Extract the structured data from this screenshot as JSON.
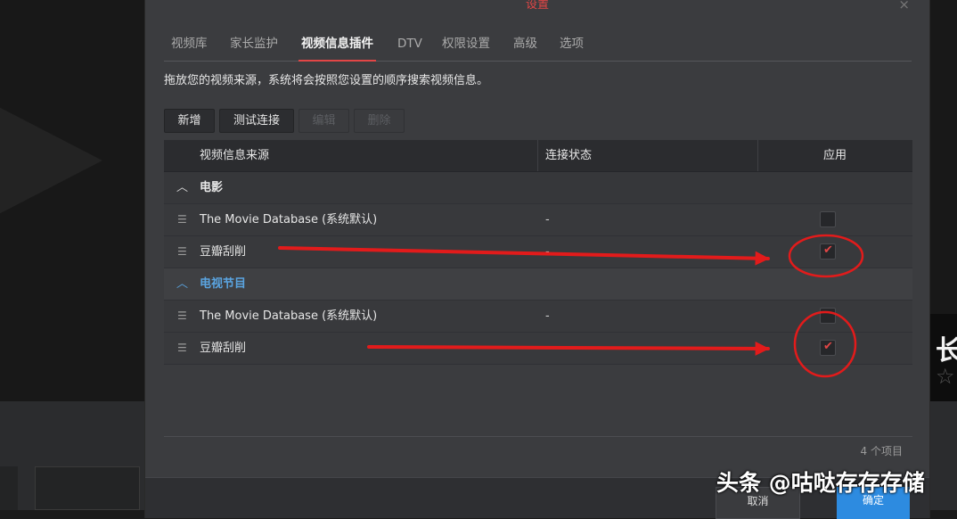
{
  "dialog": {
    "title": "设置",
    "close": "×"
  },
  "tabs": [
    {
      "label": "视频库"
    },
    {
      "label": "家长监护"
    },
    {
      "label": "视频信息插件",
      "active": true
    },
    {
      "label": "DTV"
    },
    {
      "label": "权限设置"
    },
    {
      "label": "高级"
    },
    {
      "label": "选项"
    }
  ],
  "description": "拖放您的视频来源，系统将会按照您设置的顺序搜索视频信息。",
  "toolbar": {
    "add": "新增",
    "test": "测试连接",
    "edit": "编辑",
    "delete": "删除"
  },
  "table": {
    "headers": {
      "source": "视频信息来源",
      "status": "连接状态",
      "apply": "应用"
    },
    "groups": [
      {
        "label": "电影",
        "rows": [
          {
            "name": "The Movie Database (系统默认)",
            "status": "-",
            "checked": false
          },
          {
            "name": "豆瓣刮削",
            "status": "-",
            "checked": true
          }
        ]
      },
      {
        "label": "电视节目",
        "rows": [
          {
            "name": "The Movie Database (系统默认)",
            "status": "-",
            "checked": false
          },
          {
            "name": "豆瓣刮削",
            "status": "",
            "checked": true
          }
        ]
      }
    ],
    "count": "4 个项目"
  },
  "buttons": {
    "cancel": "取消",
    "confirm": "确定"
  },
  "background": {
    "char": "长",
    "star": "☆"
  },
  "watermark": "头条 @咕哒存存存储",
  "colors": {
    "accent": "#e24646",
    "link": "#5aa4e0",
    "primary": "#2d8be0",
    "annotation": "#e21b1b"
  }
}
